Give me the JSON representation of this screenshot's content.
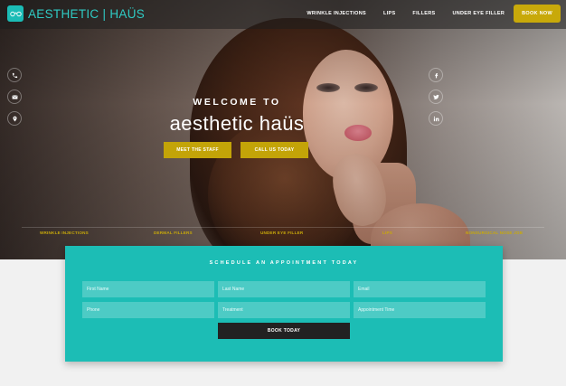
{
  "navbar": {
    "logo_text": "AESTHETIC | HAÜS",
    "items": [
      {
        "label": "WRINKLE INJECTIONS"
      },
      {
        "label": "LIPS"
      },
      {
        "label": "FILLERS"
      },
      {
        "label": "UNDER EYE FILLER"
      }
    ],
    "cta_label": "BOOK NOW"
  },
  "contact_icons": [
    "phone-icon",
    "mail-icon",
    "location-pin-icon"
  ],
  "social_icons": [
    "facebook-icon",
    "twitter-icon",
    "linkedin-icon"
  ],
  "hero": {
    "welcome": "WELCOME TO",
    "brand": "aesthetic haüs",
    "primary_button": "MEET THE STAFF",
    "secondary_button": "CALL US TODAY"
  },
  "services": [
    {
      "label": "WRINKLE INJECTIONS"
    },
    {
      "label": "DERMAL FILLERS"
    },
    {
      "label": "UNDER EYE FILLER"
    },
    {
      "label": "LIPS"
    },
    {
      "label": "NONSURGICAL NOSE JOB"
    }
  ],
  "appointment": {
    "title": "SCHEDULE AN APPOINTMENT TODAY",
    "fields": {
      "first_name": "First Name",
      "last_name": "Last Name",
      "email": "Email",
      "phone": "Phone",
      "treatment": "Treatment",
      "appointment_time": "Appointment Time"
    },
    "submit_label": "BOOK TODAY"
  },
  "colors": {
    "accent_teal": "#1cbdb5",
    "accent_gold": "#c8a90a",
    "dark_button": "#222222"
  }
}
